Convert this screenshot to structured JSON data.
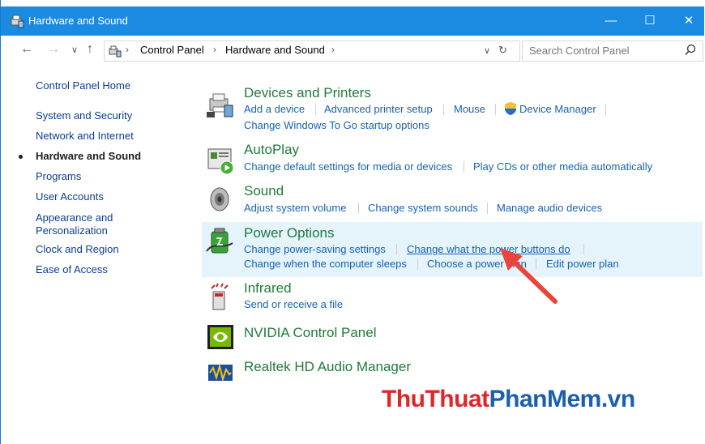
{
  "window": {
    "title": "Hardware and Sound",
    "minimize": "—",
    "maximize": "☐",
    "close": "✕"
  },
  "address": {
    "crumbs": [
      "Control Panel",
      "Hardware and Sound"
    ],
    "search_placeholder": "Search Control Panel"
  },
  "sidebar": {
    "items": [
      {
        "label": "Control Panel Home"
      },
      {
        "label": "System and Security"
      },
      {
        "label": "Network and Internet"
      },
      {
        "label": "Hardware and Sound"
      },
      {
        "label": "Programs"
      },
      {
        "label": "User Accounts"
      },
      {
        "label": "Appearance and"
      },
      {
        "label": "Personalization"
      },
      {
        "label": "Clock and Region"
      },
      {
        "label": "Ease of Access"
      }
    ]
  },
  "categories": {
    "devices": {
      "title": "Devices and Printers",
      "links": [
        "Add a device",
        "Advanced printer setup",
        "Mouse",
        "Device Manager",
        "Change Windows To Go startup options"
      ]
    },
    "autoplay": {
      "title": "AutoPlay",
      "links": [
        "Change default settings for media or devices",
        "Play CDs or other media automatically"
      ]
    },
    "sound": {
      "title": "Sound",
      "links": [
        "Adjust system volume",
        "Change system sounds",
        "Manage audio devices"
      ]
    },
    "power": {
      "title": "Power Options",
      "links": [
        "Change power-saving settings",
        "Change what the power buttons do",
        "Change when the computer sleeps",
        "Choose a power plan",
        "Edit power plan"
      ]
    },
    "infrared": {
      "title": "Infrared",
      "links": [
        "Send or receive a file"
      ]
    },
    "nvidia": {
      "title": "NVIDIA Control Panel"
    },
    "realtek": {
      "title": "Realtek HD Audio Manager"
    }
  },
  "watermark": {
    "part1": "ThuThuat",
    "part2": "PhanMem",
    "part3": ".vn",
    "color_red": "#e0262a",
    "color_blue": "#1b5fae"
  },
  "colors": {
    "titlebar": "#1a8be0",
    "link": "#1562b3",
    "category": "#207a3a",
    "highlight": "#e5f3fb",
    "arrow": "#e8453c"
  }
}
